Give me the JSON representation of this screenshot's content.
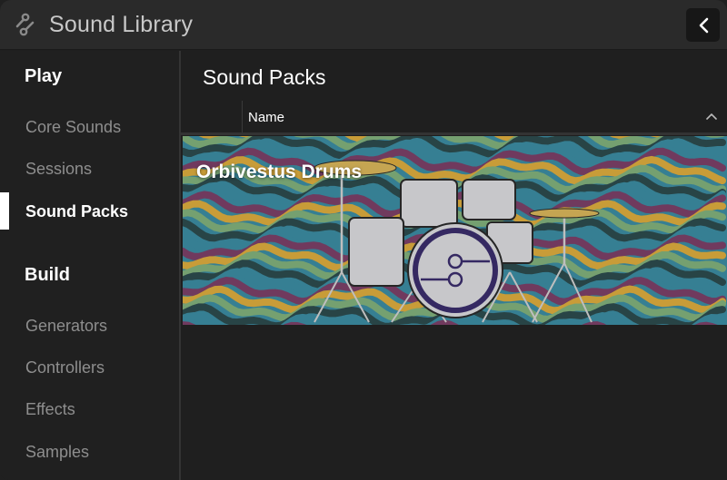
{
  "titlebar": {
    "app_icon": "connection-nodes-icon",
    "title": "Sound Library",
    "back_icon": "chevron-left-icon"
  },
  "sidebar": {
    "sections": [
      {
        "title": "Play",
        "items": [
          {
            "label": "Core Sounds",
            "active": false
          },
          {
            "label": "Sessions",
            "active": false
          },
          {
            "label": "Sound Packs",
            "active": true
          }
        ]
      },
      {
        "title": "Build",
        "items": [
          {
            "label": "Generators",
            "active": false
          },
          {
            "label": "Controllers",
            "active": false
          },
          {
            "label": "Effects",
            "active": false
          },
          {
            "label": "Samples",
            "active": false
          }
        ]
      }
    ]
  },
  "main": {
    "title": "Sound Packs",
    "columns": [
      {
        "label": "Name",
        "sort": "ascending",
        "sort_icon": "chevron-up-icon"
      }
    ],
    "packs": [
      {
        "name": "Orbivestus Drums",
        "image": "drum-kit-on-psychedelic-wavy-background"
      }
    ]
  },
  "colors": {
    "titlebar_bg": "#2a2a2a",
    "panel_bg": "#1f1f1f",
    "text_primary": "#ffffff",
    "text_muted": "#8e8e8e",
    "wave_colors": [
      "#3b8aa0",
      "#7a3f66",
      "#d9aa3d",
      "#7fae7a",
      "#2c4a4c"
    ]
  }
}
